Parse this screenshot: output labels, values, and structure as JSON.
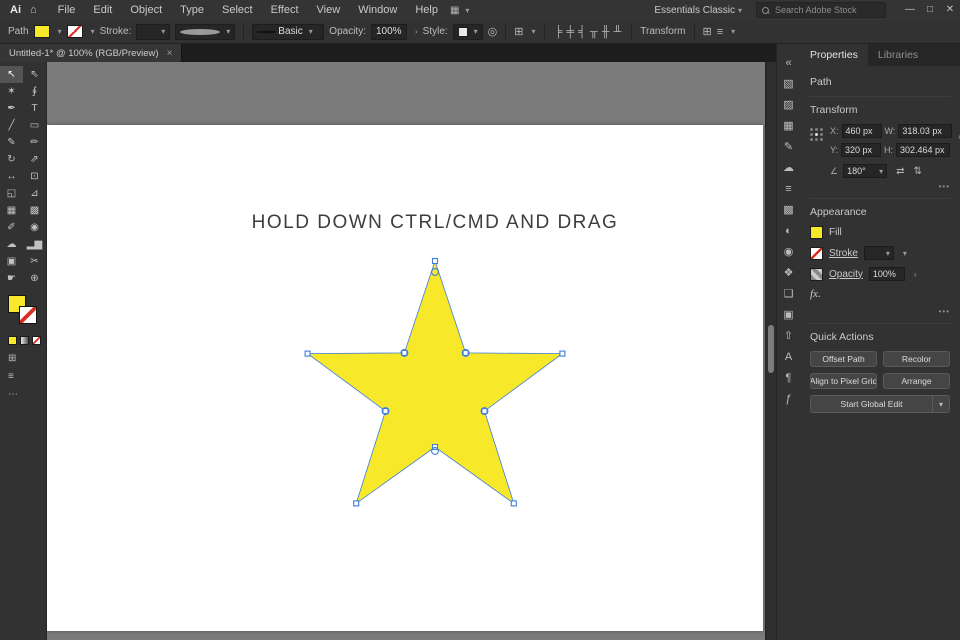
{
  "icons": {
    "chevron_down": "▾",
    "chevron_right": "›",
    "more_options": "•••",
    "angle": "∠",
    "link": "∞",
    "flip_h": "⇄",
    "flip_v": "⇅",
    "home": "⌂",
    "arrange_docs": "▦",
    "recolor": "◎",
    "document": "⊞",
    "menu": "≡",
    "overflow": "⋯",
    "collapse": "«"
  },
  "menubar": {
    "logo": "Ai",
    "menus": [
      "File",
      "Edit",
      "Object",
      "Type",
      "Select",
      "Effect",
      "View",
      "Window",
      "Help"
    ],
    "workspace": "Essentials Classic",
    "search_placeholder": "Search Adobe Stock",
    "window": {
      "minimize": "—",
      "restore": "□",
      "close": "✕"
    }
  },
  "controlbar": {
    "context_label": "Path",
    "stroke_label": "Stroke:",
    "brush_style": "Basic",
    "opacity_label": "Opacity:",
    "opacity_value": "100%",
    "style_label": "Style:",
    "transform_label": "Transform",
    "align_icons": [
      {
        "name": "align-left-icon",
        "glyph": "╞"
      },
      {
        "name": "align-center-horizontal-icon",
        "glyph": "╪"
      },
      {
        "name": "align-right-icon",
        "glyph": "╡"
      },
      {
        "name": "align-top-icon",
        "glyph": "╥"
      },
      {
        "name": "align-middle-vertical-icon",
        "glyph": "╫"
      },
      {
        "name": "align-bottom-icon",
        "glyph": "╨"
      }
    ]
  },
  "doc_tab": {
    "title": "Untitled-1* @ 100% (RGB/Preview)",
    "close": "×"
  },
  "toolbar": {
    "tools": [
      {
        "name": "selection-tool",
        "glyph": "↖",
        "selected": true
      },
      {
        "name": "direct-selection-tool",
        "glyph": "⇖"
      },
      {
        "name": "magic-wand-tool",
        "glyph": "✶"
      },
      {
        "name": "lasso-tool",
        "glyph": "∮"
      },
      {
        "name": "pen-tool",
        "glyph": "✒"
      },
      {
        "name": "type-tool",
        "glyph": "T"
      },
      {
        "name": "line-segment-tool",
        "glyph": "╱"
      },
      {
        "name": "rectangle-tool",
        "glyph": "▭"
      },
      {
        "name": "paintbrush-tool",
        "glyph": "✎"
      },
      {
        "name": "pencil-tool",
        "glyph": "✏"
      },
      {
        "name": "rotate-tool",
        "glyph": "↻"
      },
      {
        "name": "scale-tool",
        "glyph": "⇗"
      },
      {
        "name": "width-tool",
        "glyph": "↔"
      },
      {
        "name": "free-transform-tool",
        "glyph": "⊡"
      },
      {
        "name": "shape-builder-tool",
        "glyph": "◱"
      },
      {
        "name": "perspective-grid-tool",
        "glyph": "⊿"
      },
      {
        "name": "mesh-tool",
        "glyph": "▦"
      },
      {
        "name": "gradient-tool",
        "glyph": "▩"
      },
      {
        "name": "eyedropper-tool",
        "glyph": "✐"
      },
      {
        "name": "blend-tool",
        "glyph": "◉"
      },
      {
        "name": "symbol-sprayer-tool",
        "glyph": "☁"
      },
      {
        "name": "column-graph-tool",
        "glyph": "▂▆"
      },
      {
        "name": "artboard-tool",
        "glyph": "▣"
      },
      {
        "name": "slice-tool",
        "glyph": "✂"
      },
      {
        "name": "hand-tool",
        "glyph": "☛"
      },
      {
        "name": "zoom-tool",
        "glyph": "⊕"
      }
    ]
  },
  "rail": {
    "icons": [
      {
        "name": "expand-panels-icon",
        "glyph": "«"
      },
      {
        "name": "color-panel-icon",
        "glyph": "▧"
      },
      {
        "name": "color-guide-panel-icon",
        "glyph": "▨"
      },
      {
        "name": "swatches-panel-icon",
        "glyph": "▦"
      },
      {
        "name": "brushes-panel-icon",
        "glyph": "✎"
      },
      {
        "name": "symbols-panel-icon",
        "glyph": "☁"
      },
      {
        "name": "stroke-panel-icon",
        "glyph": "≡"
      },
      {
        "name": "gradient-panel-icon",
        "glyph": "▩"
      },
      {
        "name": "transparency-panel-icon",
        "glyph": "◐"
      },
      {
        "name": "appearance-panel-icon",
        "glyph": "◉"
      },
      {
        "name": "graphic-styles-panel-icon",
        "glyph": "❖"
      },
      {
        "name": "layers-panel-icon",
        "glyph": "❏"
      },
      {
        "name": "artboards-panel-icon",
        "glyph": "▣"
      },
      {
        "name": "asset-export-panel-icon",
        "glyph": "⇧"
      },
      {
        "name": "character-panel-icon",
        "glyph": "A"
      },
      {
        "name": "paragraph-panel-icon",
        "glyph": "¶"
      },
      {
        "name": "opentype-panel-icon",
        "glyph": "ƒ"
      }
    ]
  },
  "canvas": {
    "instruction": "HOLD DOWN CTRL/CMD AND DRAG",
    "star_fill": "#f7e92a",
    "selection_color": "#3f7de0"
  },
  "properties": {
    "tabs": [
      {
        "label": "Properties",
        "name": "tab-properties",
        "active": true
      },
      {
        "label": "Libraries",
        "name": "tab-libraries",
        "active": false
      }
    ],
    "object_label": "Path",
    "transform": {
      "title": "Transform",
      "x_label": "X:",
      "x_value": "460 px",
      "y_label": "Y:",
      "y_value": "320 px",
      "w_label": "W:",
      "w_value": "318.03 px",
      "h_label": "H:",
      "h_value": "302.464 px",
      "angle_value": "180°"
    },
    "appearance": {
      "title": "Appearance",
      "fill_label": "Fill",
      "stroke_label": "Stroke",
      "opacity_label": "Opacity",
      "opacity_value": "100%",
      "fx_label": "fx."
    },
    "quick_actions": {
      "title": "Quick Actions",
      "buttons": [
        "Offset Path",
        "Recolor",
        "Align to Pixel Grid",
        "Arrange"
      ],
      "split_button": "Start Global Edit"
    }
  }
}
